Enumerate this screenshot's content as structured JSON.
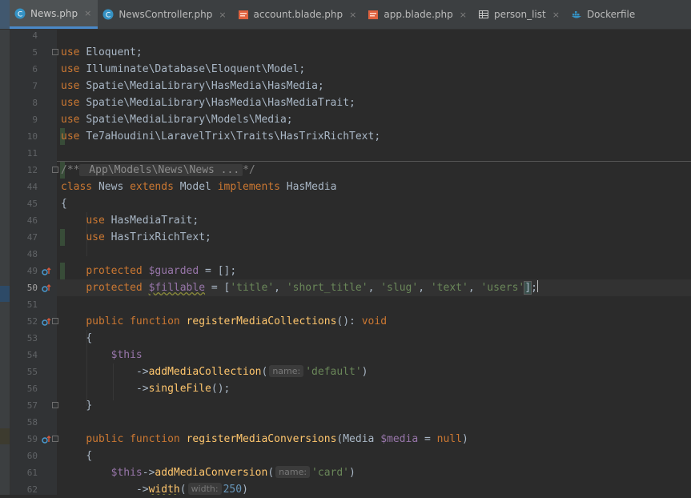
{
  "tabs": [
    {
      "label": "News.php",
      "icon": "php-class-icon",
      "active": true
    },
    {
      "label": "NewsController.php",
      "icon": "php-class-icon",
      "active": false
    },
    {
      "label": "account.blade.php",
      "icon": "blade-template-icon",
      "active": false
    },
    {
      "label": "app.blade.php",
      "icon": "blade-template-icon",
      "active": false
    },
    {
      "label": "person_list",
      "icon": "database-table-icon",
      "active": false
    },
    {
      "label": "Dockerfile",
      "icon": "docker-icon",
      "active": false
    }
  ],
  "close_glyph": "×",
  "line_numbers": [
    "4",
    "5",
    "6",
    "7",
    "8",
    "9",
    "10",
    "11",
    "12",
    "44",
    "45",
    "46",
    "47",
    "48",
    "49",
    "50",
    "51",
    "52",
    "53",
    "54",
    "55",
    "56",
    "57",
    "58",
    "59",
    "60",
    "61",
    "62"
  ],
  "code": {
    "l5": "Eloquent;",
    "l6": "Illuminate\\Database\\Eloquent\\Model;",
    "l7": "Spatie\\MediaLibrary\\HasMedia\\HasMedia;",
    "l8": "Spatie\\MediaLibrary\\HasMedia\\HasMediaTrait;",
    "l9": "Spatie\\MediaLibrary\\Models\\Media;",
    "l10": "Te7aHoudini\\LaravelTrix\\Traits\\HasTrixRichText;",
    "kw_use": "use",
    "l12_open": "/**",
    "l12_fold": " App\\Models\\News\\News ...",
    "l12_close": "*/",
    "kw_class": "class",
    "class_name": " News ",
    "kw_extends": "extends",
    "parent": " Model ",
    "kw_implements": "implements",
    "iface": " HasMedia",
    "brace_open": "{",
    "brace_close": "}",
    "trait1": " HasMediaTrait;",
    "trait2": " HasTrixRichText;",
    "kw_protected": "protected",
    "var_guarded": "$guarded",
    "guarded_val": " = [];",
    "var_fillable": "$fillable",
    "fillable_pre": " = [",
    "s_title": "'title'",
    "s_short": "'short_title'",
    "s_slug": "'slug'",
    "s_text": "'text'",
    "s_users": "'users'",
    "comma": ", ",
    "bracket_close": "]",
    "semi": ";",
    "kw_public": "public",
    "kw_function": "function",
    "fn_collections": "registerMediaCollections",
    "sig_collections": "(): ",
    "kw_void": "void",
    "var_this": "$this",
    "arrow": "->",
    "fn_addcollection": "addMediaCollection",
    "paren_open": "(",
    "hint_name": "name:",
    "s_default": "'default'",
    "paren_close": ")",
    "fn_singlefile": "singleFile",
    "call_end": "();",
    "fn_conversions": "registerMediaConversions",
    "sig_conv_open": "(Media ",
    "var_media": "$media",
    "sig_conv_rest": " = ",
    "kw_null": "null",
    "fn_addconversion": "addMediaConversion",
    "s_card": "'card'",
    "fn_width": "width",
    "hint_width": "width:",
    "num_250": "250",
    "indent": "    "
  },
  "colors": {
    "background": "#2b2b2b",
    "keyword": "#cc7832",
    "variable": "#9876aa",
    "string": "#6a8759",
    "function": "#ffc66d",
    "comment": "#808080",
    "text": "#a9b7c6",
    "tab_accent": "#4a88c7"
  },
  "gutter_icons": {
    "override": "implements-method-icon"
  }
}
